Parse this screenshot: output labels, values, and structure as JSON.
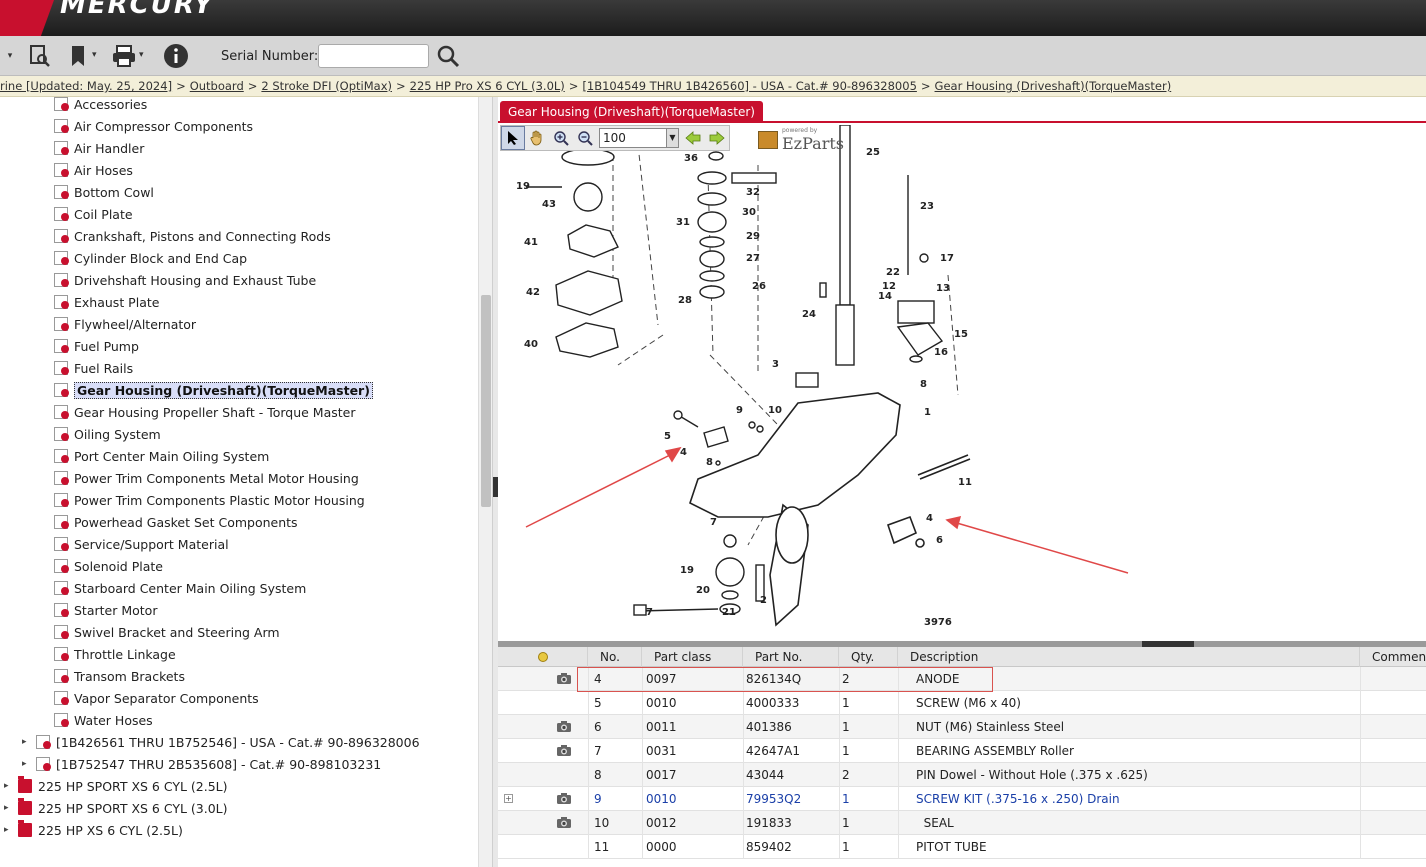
{
  "brand": {
    "name": "MERCURY"
  },
  "toolbar": {
    "serial_label": "Serial Number:",
    "serial_value": "",
    "icons": [
      "search-document-icon",
      "bookmark-icon",
      "print-icon",
      "info-icon",
      "search-icon"
    ]
  },
  "breadcrumb": {
    "items": [
      "rine [Updated: May. 25, 2024]",
      "Outboard",
      "2 Stroke DFI (OptiMax)",
      "225 HP Pro XS 6 CYL (3.0L)",
      "[1B104549 THRU 1B426560] - USA - Cat.# 90-896328005",
      "Gear Housing (Driveshaft)(TorqueMaster)"
    ],
    "separator": ">"
  },
  "tree": {
    "items": [
      "Accessories",
      "Air Compressor Components",
      "Air Handler",
      "Air Hoses",
      "Bottom Cowl",
      "Coil Plate",
      "Crankshaft, Pistons and Connecting Rods",
      "Cylinder Block and End Cap",
      "Drivehshaft Housing and Exhaust Tube",
      "Exhaust Plate",
      "Flywheel/Alternator",
      "Fuel Pump",
      "Fuel Rails",
      "Gear Housing (Driveshaft)(TorqueMaster)",
      "Gear Housing Propeller Shaft - Torque Master",
      "Oiling System",
      "Port Center Main Oiling System",
      "Power Trim Components Metal Motor Housing",
      "Power Trim Components Plastic Motor Housing",
      "Powerhead Gasket Set Components",
      "Service/Support Material",
      "Solenoid Plate",
      "Starboard Center Main Oiling System",
      "Starter Motor",
      "Swivel Bracket and Steering Arm",
      "Throttle Linkage",
      "Transom Brackets",
      "Vapor Separator Components",
      "Water Hoses"
    ],
    "selected_index": 13,
    "sub_catalogs": [
      "[1B426561 THRU 1B752546] - USA - Cat.# 90-896328006",
      "[1B752547 THRU 2B535608] - Cat.# 90-898103231"
    ],
    "models": [
      "225 HP SPORT XS 6 CYL (2.5L)",
      "225 HP SPORT XS 6 CYL (3.0L)",
      "225 HP XS 6 CYL (2.5L)"
    ]
  },
  "viewer": {
    "tab_label": "Gear Housing (Driveshaft)(TorqueMaster)",
    "zoom": "100",
    "logo_small": "powered by",
    "logo_text": "EzParts",
    "diagram_number": "3976",
    "callouts": [
      "36",
      "19",
      "43",
      "41",
      "42",
      "40",
      "32",
      "31",
      "30",
      "29",
      "27",
      "26",
      "28",
      "25",
      "23",
      "17",
      "22",
      "12",
      "13",
      "14",
      "24",
      "15",
      "16",
      "3",
      "8",
      "1",
      "9",
      "10",
      "5",
      "4",
      "8",
      "11",
      "7",
      "4",
      "6",
      "19",
      "20",
      "2",
      "21",
      "7"
    ]
  },
  "table": {
    "headers": [
      "No.",
      "Part class",
      "Part No.",
      "Qty.",
      "Description",
      "Comment"
    ],
    "rows": [
      {
        "no": "4",
        "part_class": "0097",
        "part_no": "826134Q",
        "qty": "2",
        "description": "ANODE",
        "camera": true,
        "link": false,
        "expand": false
      },
      {
        "no": "5",
        "part_class": "0010",
        "part_no": "4000333",
        "qty": "1",
        "description": "SCREW (M6 x 40)",
        "camera": false,
        "link": false,
        "expand": false
      },
      {
        "no": "6",
        "part_class": "0011",
        "part_no": "401386",
        "qty": "1",
        "description": "NUT (M6) Stainless Steel",
        "camera": true,
        "link": false,
        "expand": false
      },
      {
        "no": "7",
        "part_class": "0031",
        "part_no": "42647A1",
        "qty": "1",
        "description": "BEARING ASSEMBLY Roller",
        "camera": true,
        "link": false,
        "expand": false
      },
      {
        "no": "8",
        "part_class": "0017",
        "part_no": "43044",
        "qty": "2",
        "description": "PIN Dowel - Without Hole (.375 x .625)",
        "camera": false,
        "link": false,
        "expand": false
      },
      {
        "no": "9",
        "part_class": "0010",
        "part_no": "79953Q2",
        "qty": "1",
        "description": "SCREW KIT (.375-16 x .250) Drain",
        "camera": true,
        "link": true,
        "expand": true
      },
      {
        "no": "10",
        "part_class": "0012",
        "part_no": "191833",
        "qty": "1",
        "description": "  SEAL",
        "camera": true,
        "link": false,
        "expand": false
      },
      {
        "no": "11",
        "part_class": "0000",
        "part_no": "859402",
        "qty": "1",
        "description": "PITOT TUBE",
        "camera": false,
        "link": false,
        "expand": false
      }
    ]
  },
  "colors": {
    "accent": "#c8102e",
    "link": "#1a3fa8",
    "highlight": "#d9534f"
  }
}
